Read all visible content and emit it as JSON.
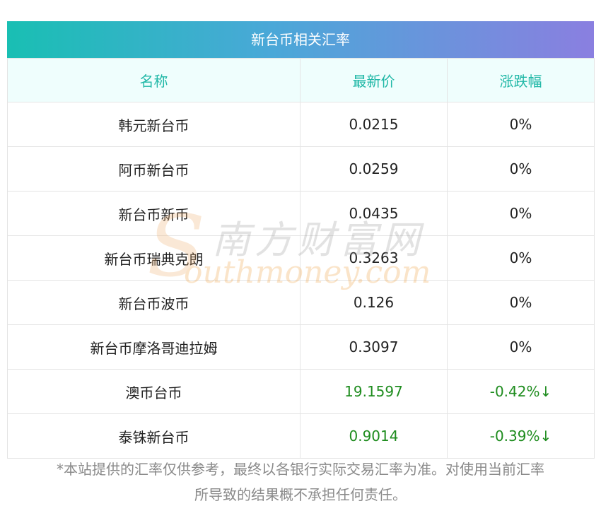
{
  "title": "新台币相关汇率",
  "headers": [
    "名称",
    "最新价",
    "涨跌幅"
  ],
  "rows": [
    {
      "name": "韩元新台币",
      "price": "0.0215",
      "change": "0%",
      "trend": "flat"
    },
    {
      "name": "阿币新台币",
      "price": "0.0259",
      "change": "0%",
      "trend": "flat"
    },
    {
      "name": "新台币新币",
      "price": "0.0435",
      "change": "0%",
      "trend": "flat"
    },
    {
      "name": "新台币瑞典克朗",
      "price": "0.3263",
      "change": "0%",
      "trend": "flat"
    },
    {
      "name": "新台币波币",
      "price": "0.126",
      "change": "0%",
      "trend": "flat"
    },
    {
      "name": "新台币摩洛哥迪拉姆",
      "price": "0.3097",
      "change": "0%",
      "trend": "flat"
    },
    {
      "name": "澳币台币",
      "price": "19.1597",
      "change": "-0.42%↓",
      "trend": "down"
    },
    {
      "name": "泰铢新台币",
      "price": "0.9014",
      "change": "-0.39%↓",
      "trend": "down"
    }
  ],
  "watermark": {
    "cn": "南方财富网",
    "en": "outhmoney.com",
    "s": "S"
  },
  "note": {
    "line1": "*本站提供的汇率仅供参考，最终以各银行实际交易汇率为准。对使用当前汇率",
    "line2": "所导致的结果概不承担任何责任。"
  },
  "colors": {
    "header_text": "#21b8a7",
    "down": "#1e8c1e",
    "title_gradient_start": "#19bfb3",
    "title_gradient_end": "#8a7fe0"
  }
}
